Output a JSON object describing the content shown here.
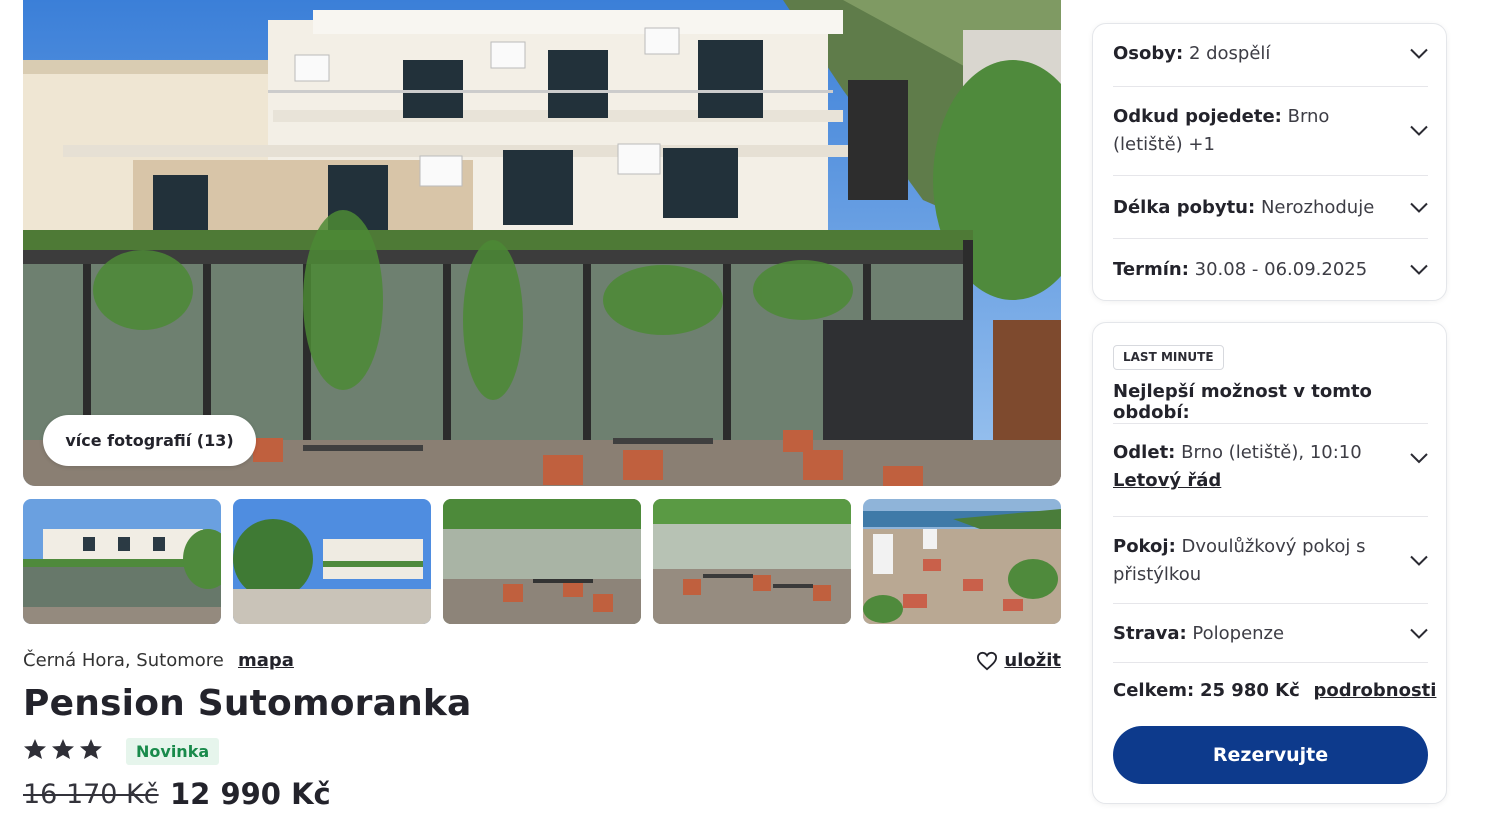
{
  "gallery": {
    "more_photos_label": "více fotografií (13)"
  },
  "hotel": {
    "location": "Černá Hora, Sutomore",
    "map_label": "mapa",
    "save_label": "uložit",
    "name": "Pension Sutomoranka",
    "star_count": 3,
    "badge": "Novinka",
    "price_old": "16 170 Kč",
    "price_new": "12 990 Kč"
  },
  "filters": {
    "persons_label": "Osoby:",
    "persons_value": "2 dospělí",
    "from_label": "Odkud pojedete:",
    "from_value": "Brno (letiště) +1",
    "length_label": "Délka pobytu:",
    "length_value": "Nerozhoduje",
    "date_label": "Termín:",
    "date_value": "30.08 - 06.09.2025"
  },
  "offer": {
    "tag": "LAST MINUTE",
    "title": "Nejlepší možnost v tomto období:",
    "departure_label": "Odlet:",
    "departure_value": "Brno (letiště), 10:10",
    "schedule_link": "Letový řád",
    "room_label": "Pokoj:",
    "room_value": "Dvoulůžkový pokoj s přistýlkou",
    "board_label": "Strava:",
    "board_value": "Polopenze",
    "total_label": "Celkem:",
    "total_value": "25 980 Kč",
    "details_link": "podrobnosti",
    "book_button": "Rezervujte"
  },
  "colors": {
    "primary_button": "#0d3a8c",
    "badge_bg": "#e6f5ec",
    "badge_text": "#198a4b"
  }
}
